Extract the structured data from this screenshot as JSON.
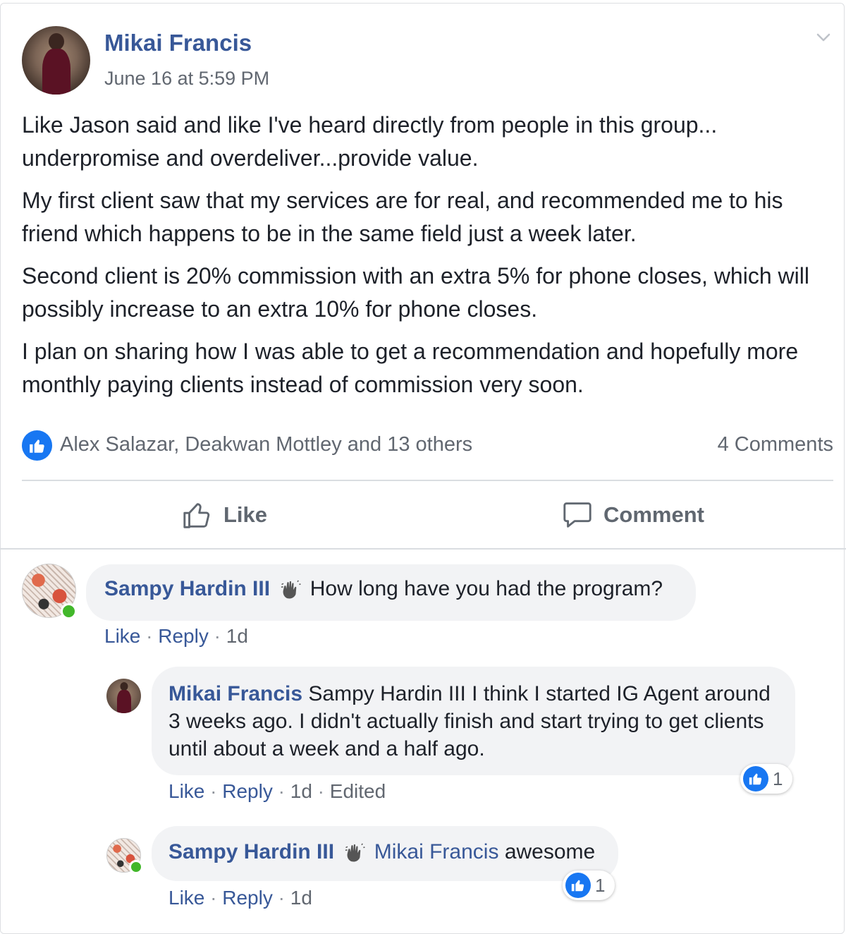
{
  "post": {
    "author": "Mikai Francis",
    "timestamp": "June 16 at 5:59 PM",
    "paragraphs": [
      "Like Jason said and like I've heard directly from people in this group... underpromise and overdeliver...provide value.",
      "My first client saw that my services are for real, and recommended me to his friend which happens to be in the same field just a week later.",
      "Second client is 20% commission with an extra 5% for phone closes, which will possibly increase to an extra 10% for phone closes.",
      "I plan on sharing how I was able to get a recommendation and hopefully more monthly paying clients instead of commission very soon."
    ],
    "reactors": "Alex Salazar, Deakwan Mottley and 13 others",
    "comments_count": "4 Comments",
    "actions": {
      "like": "Like",
      "comment": "Comment"
    }
  },
  "comments": [
    {
      "author": "Sampy Hardin III",
      "text": "How long have you had the program?",
      "meta": {
        "like": "Like",
        "reply": "Reply",
        "age": "1d"
      }
    },
    {
      "author": "Mikai Francis",
      "text": "Sampy Hardin III I think I started IG Agent around 3 weeks ago. I didn't actually finish and start trying to get clients until about a week and a half ago.",
      "meta": {
        "like": "Like",
        "reply": "Reply",
        "age": "1d",
        "edited": "Edited"
      },
      "reaction_count": "1"
    },
    {
      "author": "Sampy Hardin III",
      "mention": "Mikai Francis",
      "text": "awesome",
      "meta": {
        "like": "Like",
        "reply": "Reply",
        "age": "1d"
      },
      "reaction_count": "1"
    }
  ],
  "icons": {
    "chevron": "chevron-down-icon",
    "like_reaction": "like-reaction-icon",
    "thumbs_up": "thumbs-up-icon",
    "comment": "speech-bubble-icon",
    "wave": "waving-hand-icon"
  },
  "colors": {
    "link": "#385898",
    "accent": "#1877f2",
    "online": "#42b72a"
  }
}
